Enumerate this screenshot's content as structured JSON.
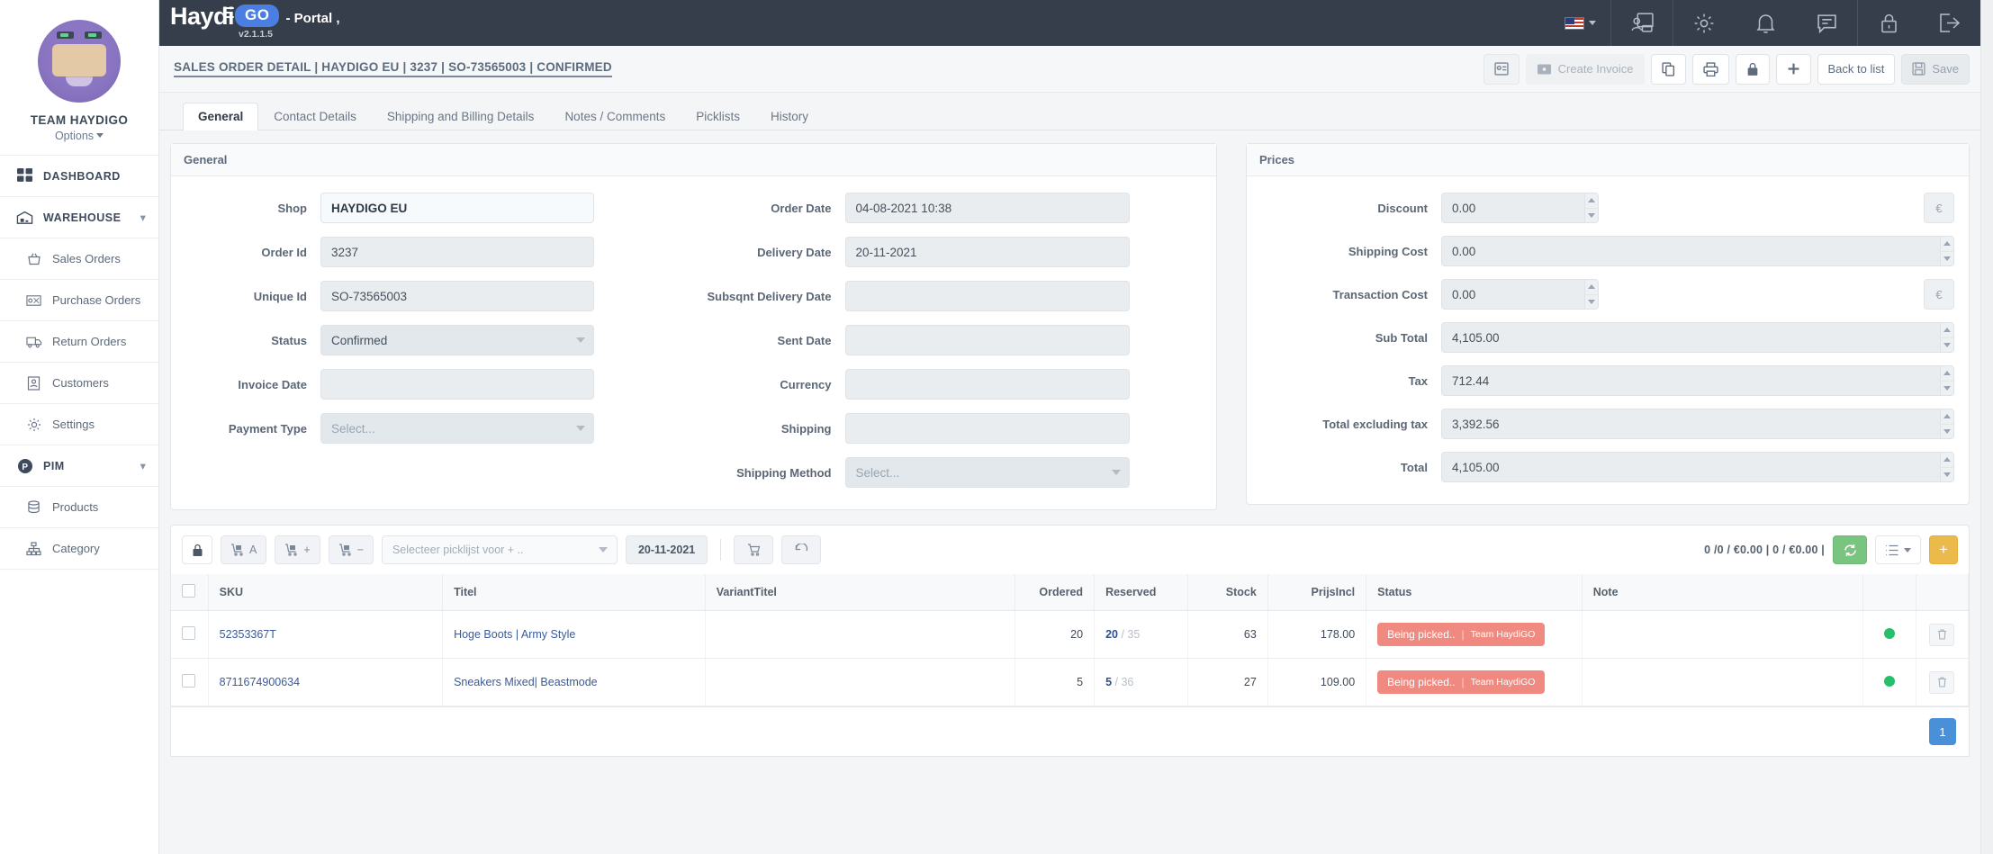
{
  "sidebar": {
    "profile": {
      "name": "TEAM HAYDIGO",
      "options_label": "Options"
    },
    "items": [
      {
        "label": "DASHBOARD",
        "icon": "grid-icon",
        "type": "head"
      },
      {
        "label": "WAREHOUSE",
        "icon": "warehouse-icon",
        "type": "head",
        "chevron": true
      },
      {
        "label": "Sales Orders",
        "icon": "basket-icon",
        "type": "sub"
      },
      {
        "label": "Purchase Orders",
        "icon": "invoice-icon",
        "type": "sub"
      },
      {
        "label": "Return Orders",
        "icon": "truck-return-icon",
        "type": "sub"
      },
      {
        "label": "Customers",
        "icon": "contact-card-icon",
        "type": "sub"
      },
      {
        "label": "Settings",
        "icon": "gear-icon",
        "type": "sub"
      },
      {
        "label": "PIM",
        "icon": "pim-icon",
        "type": "head",
        "chevron": true
      },
      {
        "label": "Products",
        "icon": "database-icon",
        "type": "sub"
      },
      {
        "label": "Category",
        "icon": "sitemap-icon",
        "type": "sub"
      }
    ]
  },
  "topbar": {
    "brand_main": "Haydi",
    "brand_badge": "GO",
    "brand_suffix": "- Portal ,",
    "version": "v2.1.1.5",
    "language": "US",
    "icons": [
      "user-card-icon",
      "gear-icon",
      "bell-icon",
      "chat-icon",
      "lock-icon",
      "logout-icon"
    ]
  },
  "pagehead": {
    "breadcrumb": "SALES ORDER DETAIL | HAYDIGO EU | 3237 | SO-73565003 | CONFIRMED",
    "actions": {
      "contact_card": "",
      "create_invoice": "Create Invoice",
      "copy": "",
      "print": "",
      "lock": "",
      "add": "",
      "back_to_list": "Back to list",
      "save": "Save"
    }
  },
  "tabs": [
    {
      "label": "General",
      "active": true
    },
    {
      "label": "Contact Details",
      "active": false
    },
    {
      "label": "Shipping and Billing Details",
      "active": false
    },
    {
      "label": "Notes / Comments",
      "active": false
    },
    {
      "label": "Picklists",
      "active": false
    },
    {
      "label": "History",
      "active": false
    }
  ],
  "general": {
    "title": "General",
    "left": [
      {
        "label": "Shop",
        "value": "HAYDIGO EU",
        "kind": "text-highlight"
      },
      {
        "label": "Order Id",
        "value": "3237",
        "kind": "text"
      },
      {
        "label": "Unique Id",
        "value": "SO-73565003",
        "kind": "text"
      },
      {
        "label": "Status",
        "value": "Confirmed",
        "kind": "select"
      },
      {
        "label": "Invoice Date",
        "value": "",
        "kind": "text"
      },
      {
        "label": "Payment Type",
        "value": "",
        "placeholder": "Select...",
        "kind": "select"
      }
    ],
    "right": [
      {
        "label": "Order Date",
        "value": "04-08-2021 10:38",
        "kind": "text"
      },
      {
        "label": "Delivery Date",
        "value": "20-11-2021",
        "kind": "text"
      },
      {
        "label": "Subsqnt Delivery Date",
        "value": "",
        "kind": "text"
      },
      {
        "label": "Sent Date",
        "value": "",
        "kind": "text"
      },
      {
        "label": "Currency",
        "value": "",
        "kind": "text"
      },
      {
        "label": "Shipping",
        "value": "",
        "kind": "text"
      },
      {
        "label": "Shipping Method",
        "value": "",
        "placeholder": "Select...",
        "kind": "select"
      }
    ]
  },
  "prices": {
    "title": "Prices",
    "currency_symbol": "€",
    "rows": [
      {
        "label": "Discount",
        "value": "0.00",
        "short": true,
        "currency": true
      },
      {
        "label": "Shipping Cost",
        "value": "0.00",
        "short": false,
        "currency": false
      },
      {
        "label": "Transaction Cost",
        "value": "0.00",
        "short": true,
        "currency": true
      },
      {
        "label": "Sub Total",
        "value": "4,105.00",
        "short": false,
        "currency": false
      },
      {
        "label": "Tax",
        "value": "712.44",
        "short": false,
        "currency": false
      },
      {
        "label": "Total excluding tax",
        "value": "3,392.56",
        "short": false,
        "currency": false
      },
      {
        "label": "Total",
        "value": "4,105.00",
        "short": false,
        "currency": false
      }
    ]
  },
  "gridtools": {
    "lock_icon": "lock-icon",
    "pick_a": "A",
    "pick_plus": "+",
    "pick_minus": "−",
    "picklist_placeholder": "Selecteer picklijst voor + ..",
    "date": "20-11-2021",
    "cart_icon": "cart-icon",
    "undo_icon": "undo-icon",
    "counts": "0 /0 / €0.00 | 0 / €0.00 |",
    "refresh_icon": "refresh-icon",
    "list_icon": "list-icon",
    "add_label": "+"
  },
  "table": {
    "columns": [
      "",
      "SKU",
      "Titel",
      "VariantTitel",
      "Ordered",
      "Reserved",
      "Stock",
      "PrijsIncl",
      "Status",
      "Note",
      "",
      ""
    ],
    "rows": [
      {
        "sku": "52353367T",
        "titel": "Hoge Boots | Army Style",
        "variant_titel": "",
        "ordered": "20",
        "reserved_bold": "20",
        "reserved_total": "/ 35",
        "stock": "63",
        "prijs_incl": "178.00",
        "status_label": "Being picked..",
        "status_team": "Team HaydiGO",
        "note": ""
      },
      {
        "sku": "8711674900634",
        "titel": "Sneakers Mixed| Beastmode",
        "variant_titel": "",
        "ordered": "5",
        "reserved_bold": "5",
        "reserved_total": "/ 36",
        "stock": "27",
        "prijs_incl": "109.00",
        "status_label": "Being picked..",
        "status_team": "Team HaydiGO",
        "note": ""
      }
    ]
  },
  "pagination": {
    "current": "1"
  },
  "colors": {
    "topbar": "#373e4b",
    "accent_blue": "#4a90d9",
    "badge_red": "#f08a81",
    "green_dot": "#27c06a",
    "amber": "#ecb94b",
    "green_btn": "#79c47f"
  }
}
